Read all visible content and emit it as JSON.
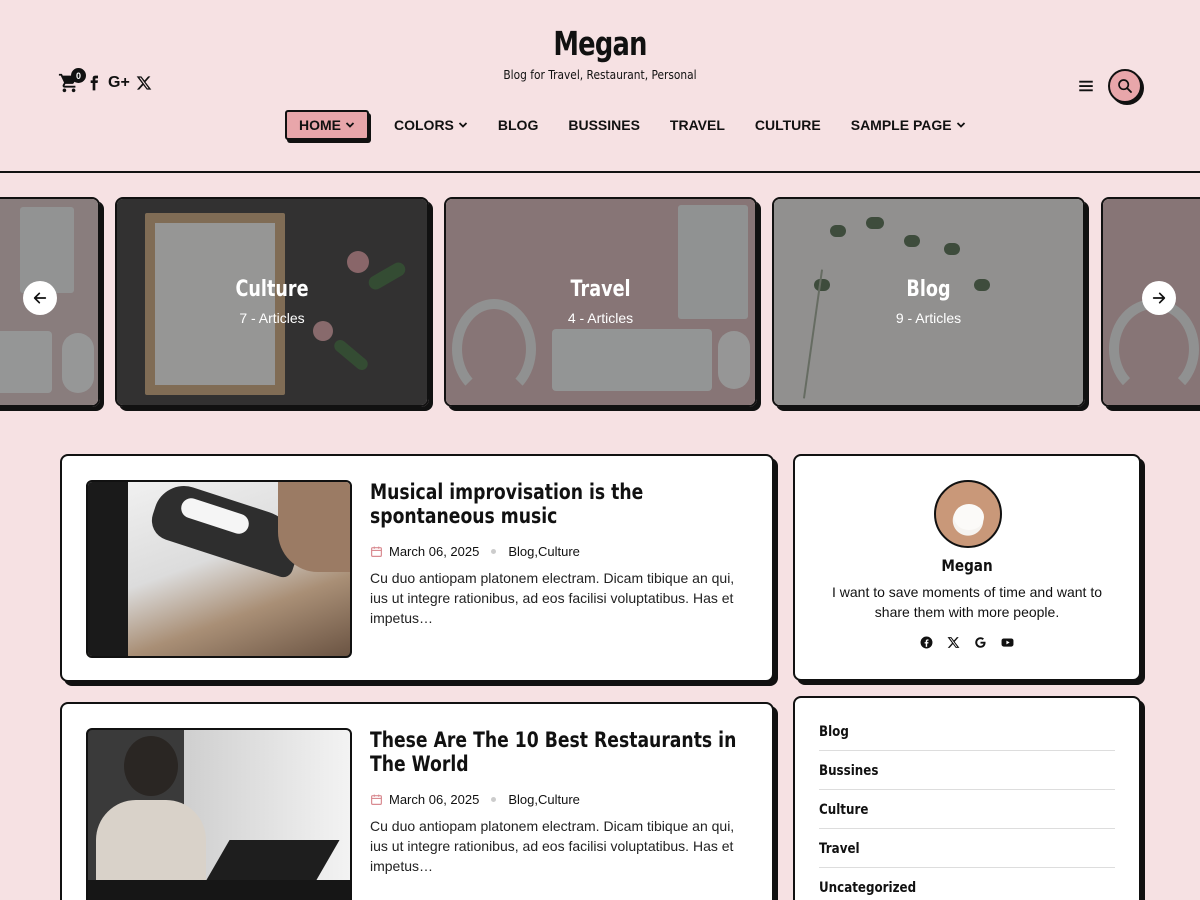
{
  "site": {
    "title": "Megan",
    "tagline": "Blog for Travel, Restaurant, Personal",
    "cart_count": "0"
  },
  "header": {
    "social_icons": [
      "facebook-icon",
      "google-plus-icon",
      "x-icon"
    ],
    "google_plus_label": "G+"
  },
  "nav": {
    "items": [
      {
        "label": "HOME",
        "has_dropdown": true,
        "active": true
      },
      {
        "label": "COLORS",
        "has_dropdown": true
      },
      {
        "label": "BLOG"
      },
      {
        "label": "BUSSINES"
      },
      {
        "label": "TRAVEL"
      },
      {
        "label": "CULTURE"
      },
      {
        "label": "SAMPLE PAGE",
        "has_dropdown": true
      }
    ]
  },
  "slider": {
    "slides": [
      {
        "title": "",
        "count": ""
      },
      {
        "title": "Culture",
        "count": "7 - Articles"
      },
      {
        "title": "Travel",
        "count": "4 - Articles"
      },
      {
        "title": "Blog",
        "count": "9 - Articles"
      },
      {
        "title": "",
        "count": ""
      }
    ]
  },
  "posts": [
    {
      "title": "Musical improvisation is the spontaneous music",
      "date": "March 06, 2025",
      "categories": "Blog,Culture",
      "excerpt": "Cu duo antiopam platonem electram. Dicam tibique an qui, ius ut integre rationibus, ad eos facilisi voluptatibus. Has et impetus…"
    },
    {
      "title": "These Are The 10 Best Restaurants in The World",
      "date": "March 06, 2025",
      "categories": "Blog,Culture",
      "excerpt": "Cu duo antiopam platonem electram. Dicam tibique an qui, ius ut integre rationibus, ad eos facilisi voluptatibus. Has et impetus…"
    }
  ],
  "author": {
    "name": "Megan",
    "bio": "I want to save moments of time and want to share them with more people.",
    "social_icons": [
      "facebook-icon",
      "x-icon",
      "google-icon",
      "youtube-icon"
    ]
  },
  "categories": {
    "items": [
      "Blog",
      "Bussines",
      "Culture",
      "Travel",
      "Uncategorized"
    ]
  },
  "colors": {
    "background": "#f6e1e3",
    "accent": "#e8a6aa",
    "border": "#111111"
  }
}
